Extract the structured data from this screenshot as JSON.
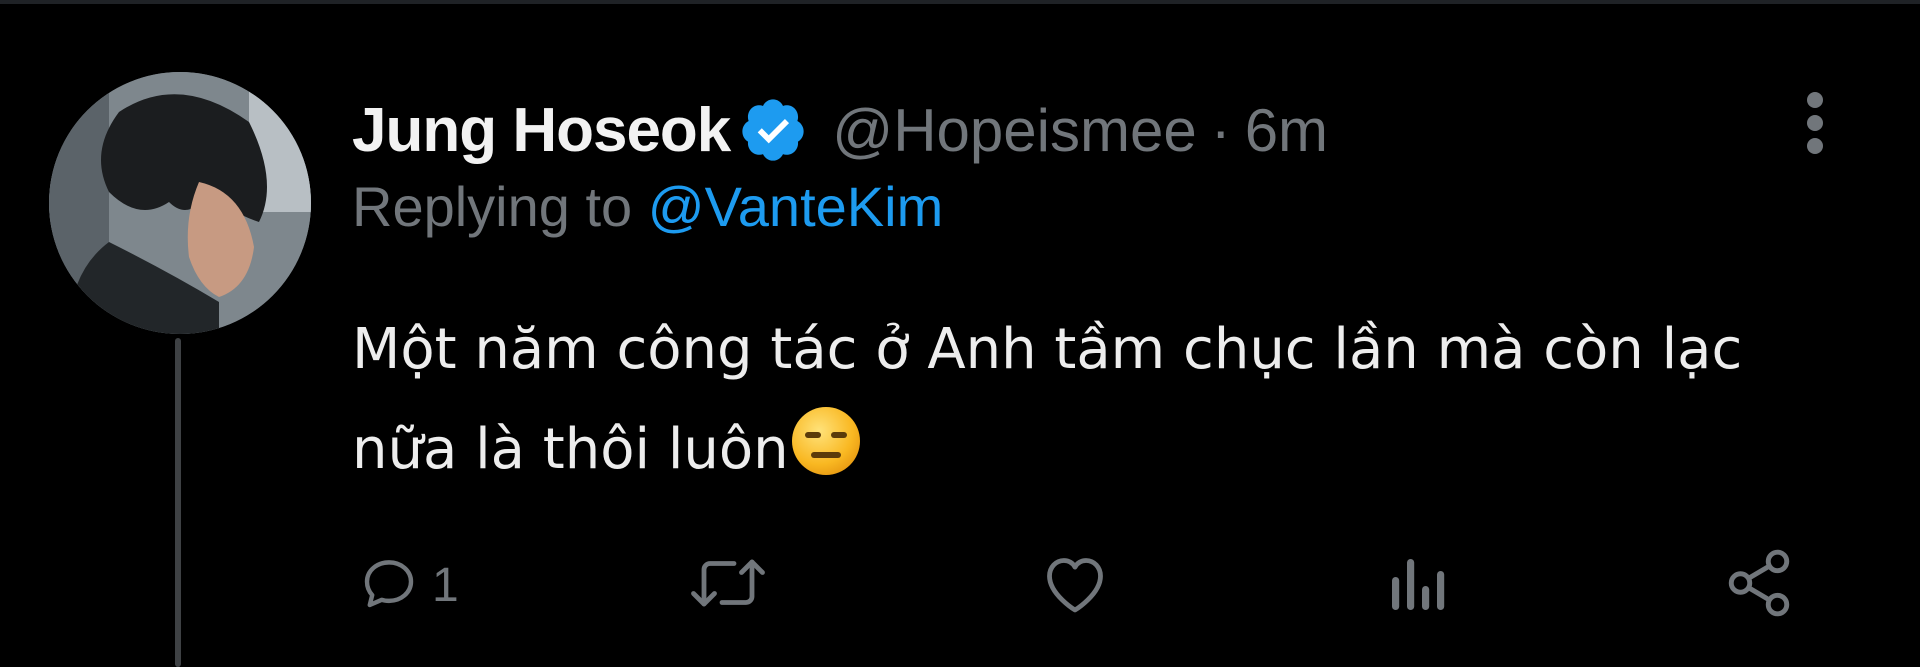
{
  "tweet": {
    "author_name": "Jung Hoseok",
    "handle": "@Hopeismee",
    "separator": "·",
    "time": "6m",
    "replying_prefix": "Replying to",
    "replying_to": "@VanteKim",
    "text_line1": "Một năm công tác ở Anh tầm chục lần mà còn lạc",
    "text_line2": "nữa là thôi luôn",
    "text_emoji": "expressionless-face-emoji"
  },
  "actions": {
    "reply_icon": "comment-icon",
    "reply_count": "1",
    "retweet_icon": "retweet-icon",
    "like_icon": "heart-icon",
    "views_icon": "views-chart-icon",
    "share_icon": "share-icon"
  },
  "colors": {
    "background": "#000000",
    "primary_text": "#e7e9ea",
    "secondary_text": "#71767b",
    "accent": "#1d9bf0",
    "thread_line": "#3e4144"
  }
}
